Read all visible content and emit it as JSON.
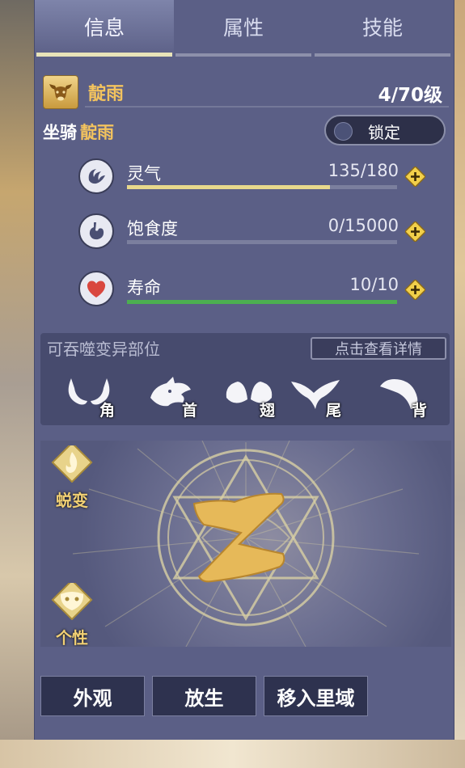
{
  "tabs": [
    {
      "label": "信息",
      "active": true
    },
    {
      "label": "属性",
      "active": false
    },
    {
      "label": "技能",
      "active": false
    }
  ],
  "pet": {
    "name": "靛雨",
    "level": "4/70级",
    "avatar_icon": "bull-head-icon"
  },
  "mount": {
    "label": "坐骑",
    "value": "靛雨",
    "lock_label": "锁定"
  },
  "stats": [
    {
      "name": "spirit",
      "label": "灵气",
      "value": "135/180",
      "fill": 0.75,
      "color": "#e8d88c",
      "icon": "spirit-swirl-icon"
    },
    {
      "name": "satiety",
      "label": "饱食度",
      "value": "0/15000",
      "fill": 0.0,
      "color": "#e8d88c",
      "icon": "stomach-icon"
    },
    {
      "name": "lifespan",
      "label": "寿命",
      "value": "10/10",
      "fill": 1.0,
      "color": "#4caf50",
      "icon": "heart-icon"
    }
  ],
  "parts": {
    "title": "可吞噬变异部位",
    "detail_label": "点击查看详情",
    "items": [
      {
        "label": "角",
        "icon": "horns-icon"
      },
      {
        "label": "首",
        "icon": "dragon-head-icon"
      },
      {
        "label": "翅",
        "icon": "wings-icon"
      },
      {
        "label": "尾",
        "icon": "fish-tail-icon"
      },
      {
        "label": "背",
        "icon": "back-fin-icon"
      }
    ]
  },
  "side_buttons": {
    "metamorph": "蜕变",
    "personality": "个性"
  },
  "actions": {
    "appearance": "外观",
    "release": "放生",
    "move": "移入里域"
  },
  "colors": {
    "panel": "#5b5f86",
    "gold_text": "#f3c35e",
    "plus_button": "#f2d04a"
  }
}
